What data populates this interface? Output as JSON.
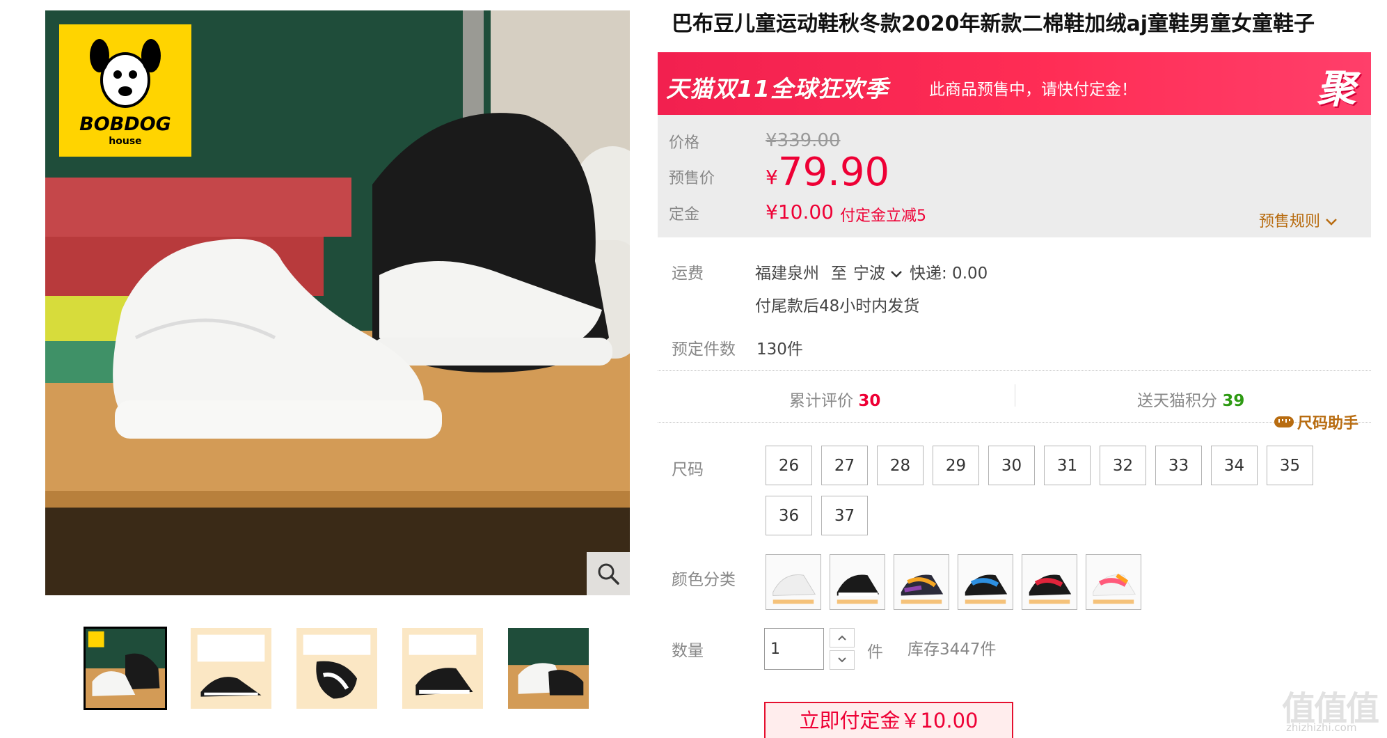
{
  "product": {
    "title": "巴布豆儿童运动鞋秋冬款2020年新款二棉鞋加绒aj童鞋男童女童鞋子"
  },
  "gallery": {
    "brand_logo_text": "BOBDOG",
    "brand_logo_sub": "house",
    "thumbnail_count": 5,
    "active_thumbnail_index": 0,
    "zoom_icon": "search-icon"
  },
  "banner": {
    "campaign": "天猫双11全球狂欢季",
    "message": "此商品预售中，请快付定金！",
    "badge": "聚"
  },
  "price": {
    "original_label": "价格",
    "original_value": "¥339.00",
    "presale_label": "预售价",
    "presale_currency": "¥",
    "presale_value": "79.90",
    "deposit_label": "定金",
    "deposit_value": "¥10.00",
    "deposit_note": "付定金立减5",
    "rules_label": "预售规则"
  },
  "shipping": {
    "label": "运费",
    "origin": "福建泉州",
    "to": "至",
    "destination": "宁波",
    "method": "快递: 0.00",
    "dispatch": "付尾款后48小时内发货"
  },
  "reservations": {
    "label": "预定件数",
    "value": "130件"
  },
  "stats": {
    "reviews_label": "累计评价",
    "reviews_value": "30",
    "points_label": "送天猫积分",
    "points_value": "39",
    "size_helper_label": "尺码助手"
  },
  "size": {
    "label": "尺码",
    "options": [
      "26",
      "27",
      "28",
      "29",
      "30",
      "31",
      "32",
      "33",
      "34",
      "35",
      "36",
      "37"
    ]
  },
  "color": {
    "label": "颜色分类",
    "swatch_count": 6
  },
  "quantity": {
    "label": "数量",
    "value": "1",
    "unit": "件",
    "stock": "库存3447件"
  },
  "actions": {
    "buy_label": "立即付定金￥10.00"
  },
  "watermark": {
    "mark": "值值值",
    "text": "zhizhizhi.com"
  },
  "colors": {
    "accent": "#ee0035",
    "rules": "#b86c10",
    "points": "#2e9a13"
  }
}
